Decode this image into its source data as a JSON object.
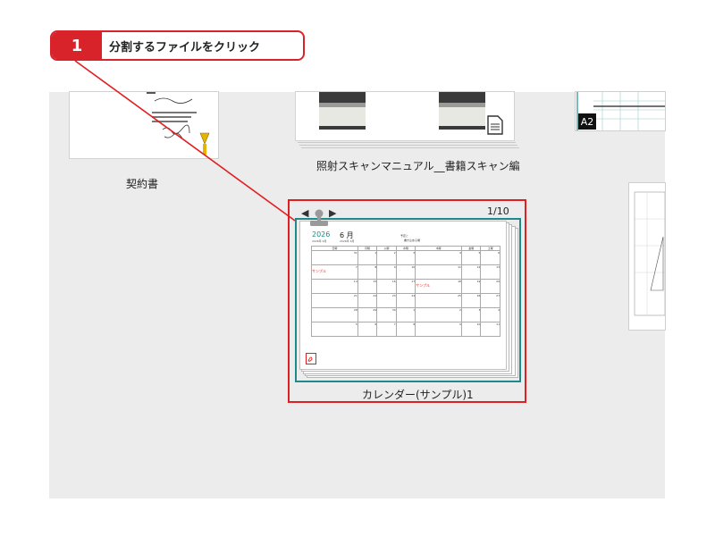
{
  "callout": {
    "number": "1",
    "text": "分割するファイルをクリック"
  },
  "files": [
    {
      "id": "contract",
      "label": "契約書"
    },
    {
      "id": "manual",
      "label": "照射スキャンマニュアル__書籍スキャン編"
    },
    {
      "id": "a2",
      "badge": "A2"
    },
    {
      "id": "calendar",
      "label": "カレンダー(サンプル)1",
      "page_counter": "1/10",
      "nav_prev": "◀",
      "nav_next": "▶"
    }
  ],
  "calendar_thumb": {
    "year": "2026",
    "month": "6 月",
    "sub1": "2026年 6月",
    "sub2": "2026年 6月",
    "memo": "予定と",
    "memo2": "書き込める欄",
    "weekdays": [
      "日曜",
      "月曜",
      "火曜",
      "水曜",
      "木曜",
      "金曜",
      "土曜"
    ],
    "weeks": [
      [
        "31",
        "1",
        "2",
        "3",
        "4",
        "5",
        "6"
      ],
      [
        "7",
        "8",
        "9",
        "10",
        "11",
        "12",
        "13"
      ],
      [
        "14",
        "15",
        "16",
        "17",
        "18",
        "19",
        "20"
      ],
      [
        "21",
        "22",
        "23",
        "24",
        "25",
        "26",
        "27"
      ],
      [
        "28",
        "29",
        "30",
        "1",
        "2",
        "3",
        "4"
      ],
      [
        "5",
        "6",
        "7",
        "8",
        "9",
        "10",
        "11"
      ]
    ],
    "sample_text": "サンプル"
  },
  "icons": {
    "clip": "stapler-icon",
    "pdf": "pdf-icon",
    "doc": "document-icon"
  },
  "colors": {
    "accent_red": "#d9232a",
    "teal": "#1e8a8a"
  }
}
